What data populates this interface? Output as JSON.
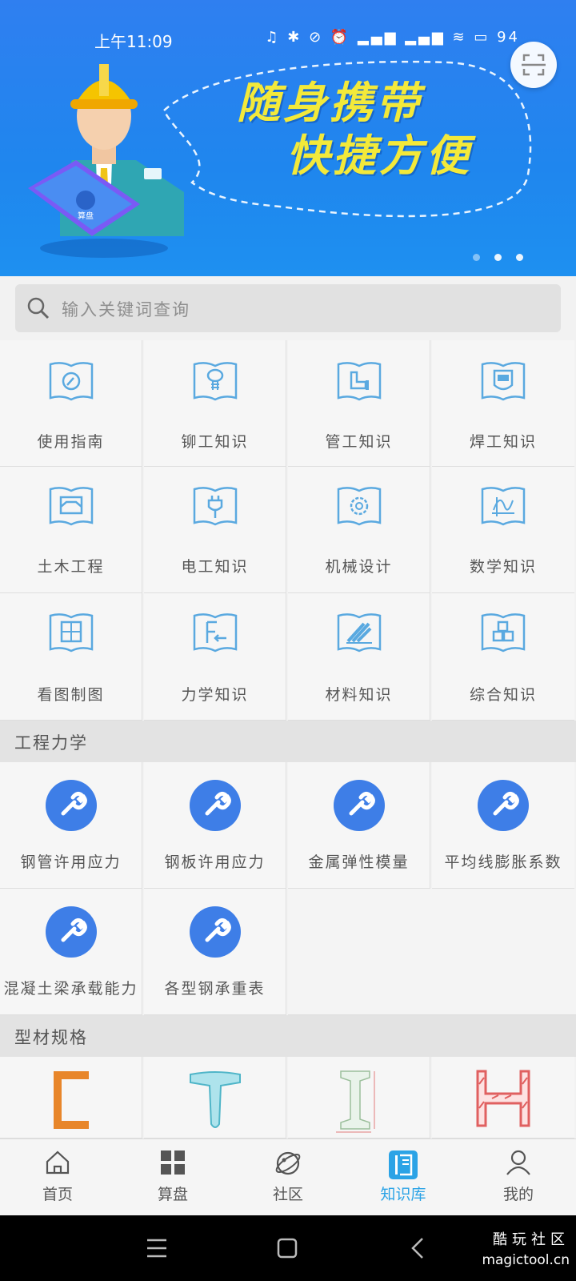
{
  "status": {
    "time": "上午11:09",
    "battery": "94"
  },
  "banner": {
    "slogan_line1": "随身携带",
    "slogan_line2": "快捷方便",
    "phone_label": "算盘"
  },
  "search": {
    "placeholder": "输入关键词查询"
  },
  "knowledge_grid": [
    {
      "label": "使用指南",
      "icon": "compass-book-icon"
    },
    {
      "label": "铆工知识",
      "icon": "rivet-book-icon"
    },
    {
      "label": "管工知识",
      "icon": "pipe-book-icon"
    },
    {
      "label": "焊工知识",
      "icon": "welding-mask-book-icon"
    },
    {
      "label": "土木工程",
      "icon": "tray-book-icon"
    },
    {
      "label": "电工知识",
      "icon": "plug-book-icon"
    },
    {
      "label": "机械设计",
      "icon": "gear-book-icon"
    },
    {
      "label": "数学知识",
      "icon": "graph-book-icon"
    },
    {
      "label": "看图制图",
      "icon": "drawing-book-icon"
    },
    {
      "label": "力学知识",
      "icon": "force-book-icon"
    },
    {
      "label": "材料知识",
      "icon": "materials-book-icon"
    },
    {
      "label": "综合知识",
      "icon": "blocks-book-icon"
    }
  ],
  "section_mechanics": {
    "title": "工程力学",
    "items": [
      {
        "label": "钢管许用应力",
        "icon": "wrench-icon"
      },
      {
        "label": "钢板许用应力",
        "icon": "wrench-icon"
      },
      {
        "label": "金属弹性模量",
        "icon": "wrench-icon"
      },
      {
        "label": "平均线膨胀系数",
        "icon": "wrench-icon"
      },
      {
        "label": "混凝土梁承载能力",
        "icon": "wrench-icon"
      },
      {
        "label": "各型钢承重表",
        "icon": "wrench-icon"
      }
    ]
  },
  "section_profiles": {
    "title": "型材规格",
    "items": [
      {
        "icon": "channel-steel-icon"
      },
      {
        "icon": "t-steel-icon"
      },
      {
        "icon": "i-beam-icon"
      },
      {
        "icon": "h-beam-icon"
      }
    ]
  },
  "tabbar": [
    {
      "label": "首页",
      "icon": "home-icon",
      "active": false
    },
    {
      "label": "算盘",
      "icon": "grid-icon",
      "active": false
    },
    {
      "label": "社区",
      "icon": "planet-icon",
      "active": false
    },
    {
      "label": "知识库",
      "icon": "book-icon",
      "active": true
    },
    {
      "label": "我的",
      "icon": "person-icon",
      "active": false
    }
  ],
  "watermark": {
    "line1": "酷玩社区",
    "line2": "magictool.cn"
  },
  "colors": {
    "accent": "#2ba3e6",
    "banner_blue": "#1f86ee",
    "wrench_blue": "#3e7ee7",
    "slogan_yellow": "#f3e93a"
  }
}
